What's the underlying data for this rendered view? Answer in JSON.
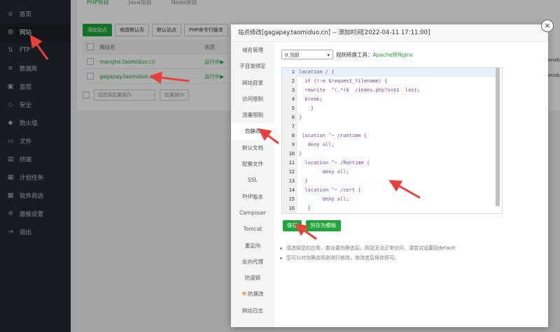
{
  "sidebar": {
    "items": [
      {
        "label": "首页",
        "icon": "home-icon",
        "glyph": "⌂"
      },
      {
        "label": "网站",
        "icon": "globe-icon",
        "glyph": "◎",
        "active": true
      },
      {
        "label": "FTP",
        "icon": "ftp-icon",
        "glyph": "⇅"
      },
      {
        "label": "数据库",
        "icon": "database-icon",
        "glyph": "≡"
      },
      {
        "label": "监控",
        "icon": "monitor-icon",
        "glyph": "▣"
      },
      {
        "label": "安全",
        "icon": "shield-icon",
        "glyph": "◇"
      },
      {
        "label": "防火墙",
        "icon": "firewall-icon",
        "glyph": "◆"
      },
      {
        "label": "文件",
        "icon": "folder-icon",
        "glyph": "▭"
      },
      {
        "label": "终端",
        "icon": "terminal-icon",
        "glyph": "▤"
      },
      {
        "label": "计划任务",
        "icon": "calendar-icon",
        "glyph": "▦"
      },
      {
        "label": "软件商店",
        "icon": "store-icon",
        "glyph": "▩"
      },
      {
        "label": "面板设置",
        "icon": "gear-icon",
        "glyph": "✲"
      },
      {
        "label": "退出",
        "icon": "logout-icon",
        "glyph": "⇥"
      }
    ]
  },
  "tabs": [
    "PHP项目",
    "Java项目",
    "Node项目"
  ],
  "toolbar": {
    "add_site": "添加站点",
    "modify_default": "修改默认页",
    "default_site": "默认站点",
    "php_cli": "PHP命令行版本"
  },
  "table": {
    "header_name": "网站名",
    "header_status": "状态",
    "rows": [
      {
        "name": "manghe.taomiduo.cn",
        "status": "运行中▶"
      },
      {
        "name": "gagapay.taomiduo.cn",
        "status": "运行中▶"
      }
    ]
  },
  "batch": {
    "select_placeholder": "请选择批量操作",
    "button": "批量操作"
  },
  "right_fragments": [
    "omidu",
    "omidu"
  ],
  "modal": {
    "title": "站点修改[gagapay.taomiduo.cn] -- 添加时间[2022-04-11 17:11:00]",
    "close_glyph": "×",
    "side_items": [
      {
        "label": "域名管理"
      },
      {
        "label": "子目录绑定"
      },
      {
        "label": "网站目录"
      },
      {
        "label": "访问限制"
      },
      {
        "label": "流量限制"
      },
      {
        "label": "伪静态",
        "active": true
      },
      {
        "label": "默认文档"
      },
      {
        "label": "配置文件"
      },
      {
        "label": "SSL"
      },
      {
        "label": "PHP版本"
      },
      {
        "label": "Composer"
      },
      {
        "label": "Tomcat"
      },
      {
        "label": "重定向"
      },
      {
        "label": "反向代理"
      },
      {
        "label": "防盗链"
      },
      {
        "label": "防篡改",
        "badge": true
      },
      {
        "label": "网站日志"
      }
    ],
    "version_select": "0.当前",
    "convert_label": "规则转换工具：",
    "convert_link": "Apache转Nginx",
    "code_lines": [
      {
        "n": "1",
        "code": "location / {"
      },
      {
        "n": "2",
        "code": "  if (!-e $request_filename) {"
      },
      {
        "n": "3",
        "code": "  rewrite  ^(.*)$  /index.php?s=$1  last;"
      },
      {
        "n": "4",
        "code": "  break;"
      },
      {
        "n": "5",
        "code": "    }"
      },
      {
        "n": "6",
        "code": "}"
      },
      {
        "n": "7",
        "code": ""
      },
      {
        "n": "8",
        "code": " location ^~ /runtime {"
      },
      {
        "n": "9",
        "code": "   deny all;"
      },
      {
        "n": "10",
        "code": "}"
      },
      {
        "n": "11",
        "code": "  location ^~ /Runtime {"
      },
      {
        "n": "12",
        "code": "        deny all;"
      },
      {
        "n": "13",
        "code": "  }"
      },
      {
        "n": "14",
        "code": "  location ^~ /cert {"
      },
      {
        "n": "15",
        "code": "        deny all;"
      },
      {
        "n": "16",
        "code": "   }"
      }
    ],
    "save_button": "保存",
    "save_template_button": "另存为模板",
    "tips": [
      "请选择您的应用，若设置伪静态后，网站无法正常访问，请尝试设置回default",
      "您可以对伪静态规则进行修改，修改完后保存即可。"
    ]
  },
  "colors": {
    "accent": "#20a53a",
    "sidebar_bg": "#222a33",
    "arrow": "#e8413a"
  }
}
